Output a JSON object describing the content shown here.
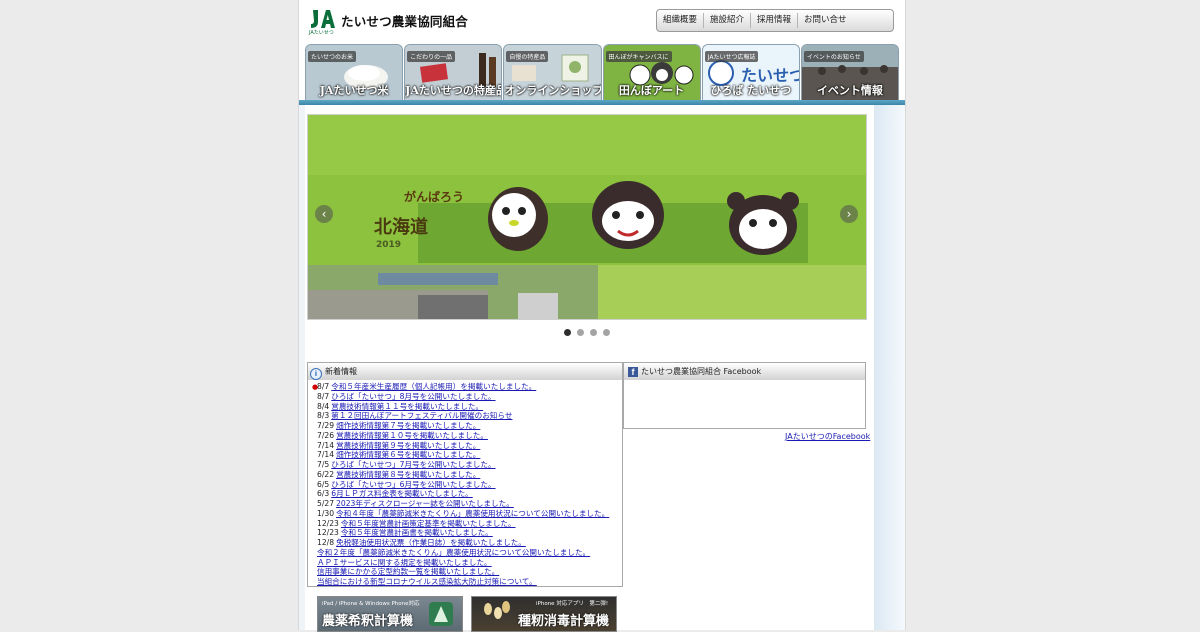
{
  "header": {
    "logo_text": "JA",
    "logo_sub": "JAたいせつ",
    "org_name": "たいせつ農業協同組合"
  },
  "top_nav": [
    {
      "label": "組織概要"
    },
    {
      "label": "施設紹介"
    },
    {
      "label": "採用情報"
    },
    {
      "label": "お問い合せ"
    }
  ],
  "category_tabs": [
    {
      "sub": "たいせつのお米",
      "main": "JAたいせつ米"
    },
    {
      "sub": "こだわりの一品",
      "main": "JAたいせつの特産品"
    },
    {
      "sub": "自慢の特産品",
      "main": "オンラインショップ"
    },
    {
      "sub": "田んぼがキャンバスに",
      "main": "田んぼアート"
    },
    {
      "sub": "JAたいせつ広報誌",
      "main": "ひろば たいせつ"
    },
    {
      "sub": "イベントのお知らせ",
      "main": "イベント情報"
    }
  ],
  "slider": {
    "field_text_main": "北海道",
    "field_text_side": "がんばろう",
    "field_text_year": "2019",
    "prev_icon": "chevron-left-icon",
    "next_icon": "chevron-right-icon",
    "slide_count": 4,
    "active_index": 0
  },
  "news": {
    "heading": "新着情報",
    "items": [
      {
        "date": "8/7",
        "text": "令和５年産米生産履歴（個人記帳用）を掲載いたしました。",
        "new": true
      },
      {
        "date": "8/7",
        "text": "ひろば「たいせつ」8月号を公開いたしました。",
        "new": false
      },
      {
        "date": "8/4",
        "text": "営農技術情報第１１号を掲載いたしました。",
        "new": false
      },
      {
        "date": "8/3",
        "text": "第１２回田んぼアートフェスティバル開催のお知らせ",
        "new": false
      },
      {
        "date": "7/29",
        "text": "畑作技術情報第７号を掲載いたしました。",
        "new": false
      },
      {
        "date": "7/26",
        "text": "営農技術情報第１０号を掲載いたしました。",
        "new": false
      },
      {
        "date": "7/14",
        "text": "営農技術情報第９号を掲載いたしました。",
        "new": false
      },
      {
        "date": "7/14",
        "text": "畑作技術情報第６号を掲載いたしました。",
        "new": false
      },
      {
        "date": "7/5",
        "text": "ひろば「たいせつ」7月号を公開いたしました。",
        "new": false
      },
      {
        "date": "6/22",
        "text": "営農技術情報第８号を掲載いたしました。",
        "new": false
      },
      {
        "date": "6/5",
        "text": "ひろば「たいせつ」6月号を公開いたしました。",
        "new": false
      },
      {
        "date": "6/3",
        "text": "6月ＬＰガス料金表を掲載いたしました。",
        "new": false
      },
      {
        "date": "5/27",
        "text": "2023年ディスクロージャー誌を公開いたしました。",
        "new": false
      },
      {
        "date": "1/30",
        "text": "令和４年度「農薬節減米きたくりん」農薬使用状況について公開いたしました。",
        "new": false
      },
      {
        "date": "12/23",
        "text": "令和５年度営農計画策定基準を掲載いたしました。",
        "new": false
      },
      {
        "date": "12/23",
        "text": "令和５年度営農計画書を掲載いたしました。",
        "new": false
      },
      {
        "date": "12/8",
        "text": "免税軽油使用状況票（作業日誌）を掲載いたしました。",
        "new": false
      },
      {
        "date": "",
        "text": "令和２年度「農薬節減米きたくりん」農薬使用状況について公開いたしました。",
        "new": false
      },
      {
        "date": "",
        "text": "ＡＰＩサービスに関する規定を掲載いたしました。",
        "new": false
      },
      {
        "date": "",
        "text": "信用事業にかかる定型約款一覧を掲載いたしました。",
        "new": false
      },
      {
        "date": "",
        "text": "当組合における新型コロナウイルス感染拡大防止対策について。",
        "new": false
      }
    ]
  },
  "facebook": {
    "heading": "たいせつ農業協同組合 Facebook",
    "link": "JAたいせつのFacebook"
  },
  "banners": [
    {
      "small": "iPad / iPhone & Windows Phone対応",
      "big": "農薬希釈計算機"
    },
    {
      "small": "iPhone 対応アプリ　第二弾!",
      "big": "種籾消毒計算機"
    }
  ],
  "colors": {
    "accent_blue": "#3b86a8",
    "link_blue": "#1a1ab4",
    "field_green": "#8bc23c"
  }
}
